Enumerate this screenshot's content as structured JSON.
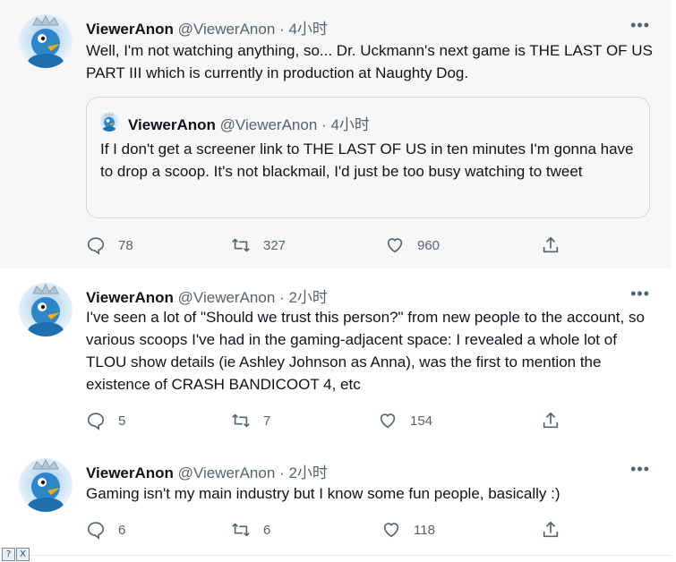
{
  "tweets": [
    {
      "name": "ViewerAnon",
      "handle": "@ViewerAnon",
      "dot": "·",
      "time": "4小时",
      "text": "Well, I'm not watching anything, so... Dr. Uckmann's next game is THE LAST OF US PART III which is currently in production at Naughty Dog.",
      "quote": {
        "name": "ViewerAnon",
        "handle": "@ViewerAnon",
        "dot": "·",
        "time": "4小时",
        "text": "If I don't get a screener link to THE LAST OF US in ten minutes I'm gonna have to drop a scoop. It's not blackmail, I'd just be too busy watching to tweet"
      },
      "replies": "78",
      "retweets": "327",
      "likes": "960"
    },
    {
      "name": "ViewerAnon",
      "handle": "@ViewerAnon",
      "dot": "·",
      "time": "2小时",
      "text": "I've seen a lot of \"Should we trust this person?\" from new people to the account, so various scoops I've had in the gaming-adjacent space: I revealed a whole lot of TLOU show details (ie Ashley Johnson as Anna), was the first to mention the existence of CRASH BANDICOOT 4, etc",
      "replies": "5",
      "retweets": "7",
      "likes": "154"
    },
    {
      "name": "ViewerAnon",
      "handle": "@ViewerAnon",
      "dot": "·",
      "time": "2小时",
      "text": "Gaming isn't my main industry but I know some fun people, basically :)",
      "replies": "6",
      "retweets": "6",
      "likes": "118"
    }
  ],
  "more_label": "•••",
  "icons": {
    "reply": "reply-icon",
    "retweet": "retweet-icon",
    "like": "heart-icon",
    "share": "share-icon",
    "more": "more-icon"
  },
  "colors": {
    "accent": "#1d9bf0",
    "secondary_text": "#536471",
    "highlight_bg": "#f7f7f7",
    "thread_line": "#cfd9de"
  },
  "footer": {
    "help_label": "?",
    "close_label": "X"
  }
}
